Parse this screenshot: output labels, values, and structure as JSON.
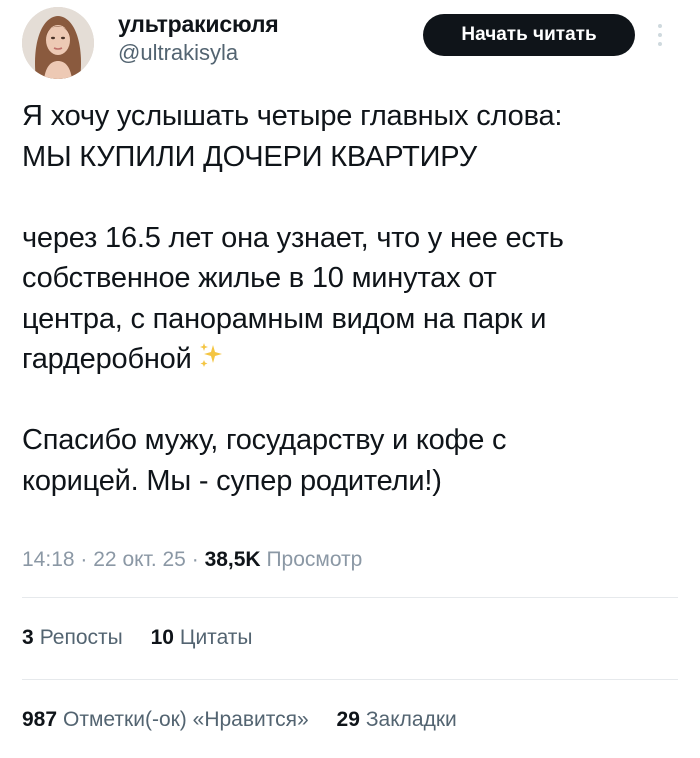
{
  "user": {
    "display_name": "ультракисюля",
    "handle": "@ultrakisyla"
  },
  "header": {
    "follow_label": "Начать читать",
    "more_icon": "more-vertical-icon"
  },
  "tweet": {
    "lines": [
      "Я хочу услышать четыре главных слова:",
      "МЫ КУПИЛИ ДОЧЕРИ КВАРТИРУ",
      "через 16.5 лет она узнает, что у нее есть",
      "собственное жилье в 10 минутах от",
      "центра, с панорамным видом на парк и",
      "гардеробной",
      "Спасибо мужу, государству и кофе с",
      "корицей. Мы - супер родители!)"
    ],
    "emoji": "sparkles-icon"
  },
  "meta": {
    "time": "14:18",
    "date": "22 окт. 25",
    "separator": "·",
    "views_count": "38,5K",
    "views_label": "Просмотр"
  },
  "stats": {
    "reposts_count": "3",
    "reposts_label": "Репосты",
    "quotes_count": "10",
    "quotes_label": "Цитаты",
    "likes_count": "987",
    "likes_label": "Отметки(-ок) «Нравится»",
    "bookmarks_count": "29",
    "bookmarks_label": "Закладки"
  },
  "colors": {
    "text": "#0f1419",
    "secondary": "#536471",
    "meta": "#8b98a5",
    "divider": "#e6e9ec",
    "button_bg": "#0f1419",
    "sparkle": "#f4c542"
  }
}
